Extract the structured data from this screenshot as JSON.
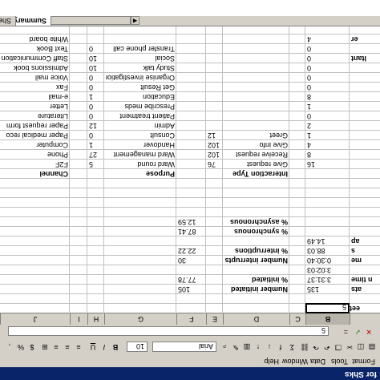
{
  "window": {
    "title": "for Shks"
  },
  "menu": [
    "Format",
    "Tools",
    "Data",
    "Window",
    "Help"
  ],
  "toolbar": {
    "font_name": "Arial",
    "font_size": "10",
    "bold": "B",
    "italic": "I",
    "underline": "U",
    "sum": "Σ",
    "fx": "f",
    "dollar": "$",
    "percent": "%"
  },
  "formula_bar": {
    "cancel": "✕",
    "confirm": "✓",
    "equals": "=",
    "value": "5"
  },
  "columns": [
    "B",
    "C",
    "D",
    "E",
    "F",
    "G",
    "H",
    "I",
    "J"
  ],
  "sheet_tabs": [
    "Summary",
    "Sheet"
  ],
  "left_column": {
    "label_sheet": "eet",
    "items": [
      {
        "label": "ats",
        "value": "135"
      },
      {
        "label": "n time",
        "value": "3:31:37"
      },
      {
        "label": "",
        "value": "3:02:03"
      },
      {
        "label": "me",
        "value": "0:30:40"
      },
      {
        "label": "s",
        "value": "88.03"
      },
      {
        "label": "ap",
        "value": "14.49"
      }
    ],
    "active_value": "5"
  },
  "stats": [
    {
      "label": "Number initiated",
      "value": "105"
    },
    {
      "label": "% initiated",
      "value": "77.78"
    },
    {
      "label": "Number interrupts",
      "value": "30"
    },
    {
      "label": "% interruptions",
      "value": "22.22"
    },
    {
      "label": "% synchronous",
      "value": "87.41"
    },
    {
      "label": "% asynchronous",
      "value": "12.59"
    }
  ],
  "headers": {
    "interaction_type": "Interaction Type",
    "purpose": "Purpose",
    "channel": "Channel"
  },
  "table_rows": [
    {
      "a_label": "",
      "a_val": "16",
      "d": "Give request",
      "e": "76",
      "g": "Ward round",
      "h": "5",
      "j": "F2F"
    },
    {
      "a_label": "",
      "a_val": "8",
      "d": "Receive request",
      "e": "102",
      "g": "Ward management",
      "h": "27",
      "j": "Phone"
    },
    {
      "a_label": "",
      "a_val": "4",
      "d": "Give info",
      "e": "102",
      "g": "Handover",
      "h": "1",
      "j": "Computer"
    },
    {
      "a_label": "",
      "a_val": "1",
      "d": "Greet",
      "e": "12",
      "g": "Consult",
      "h": "0",
      "j": "Paper medical reco"
    },
    {
      "a_label": "",
      "a_val": "2",
      "d": "",
      "e": "",
      "g": "Admin",
      "h": "12",
      "j": "Paper request form"
    },
    {
      "a_label": "",
      "a_val": "0",
      "d": "",
      "e": "",
      "g": "Patient treatment",
      "h": "0",
      "j": "Literature"
    },
    {
      "a_label": "",
      "a_val": "1",
      "d": "",
      "e": "",
      "g": "Prescribe meds",
      "h": "0",
      "j": "Letter"
    },
    {
      "a_label": "",
      "a_val": "8",
      "d": "",
      "e": "",
      "g": "Education",
      "h": "1",
      "j": "e-mail"
    },
    {
      "a_label": "",
      "a_val": "0",
      "d": "",
      "e": "",
      "g": "Get Result",
      "h": "0",
      "j": "Fax"
    },
    {
      "a_label": "",
      "a_val": "0",
      "d": "",
      "e": "",
      "g": "Organise investigation",
      "h": "0",
      "j": "Voice mail"
    },
    {
      "a_label": "",
      "a_val": "0",
      "d": "",
      "e": "",
      "g": "Study talk",
      "h": "10",
      "j": "Admissions book"
    },
    {
      "a_label": "ltant",
      "a_val": "0",
      "d": "",
      "e": "",
      "g": "Social",
      "h": "10",
      "j": "Staff Communication"
    },
    {
      "a_label": "",
      "a_val": "0",
      "d": "",
      "e": "",
      "g": "Transfer phone call",
      "h": "0",
      "j": "Text Book"
    },
    {
      "a_label": "er",
      "a_val": "4",
      "d": "",
      "e": "",
      "g": "",
      "h": "",
      "j": "White board"
    }
  ]
}
